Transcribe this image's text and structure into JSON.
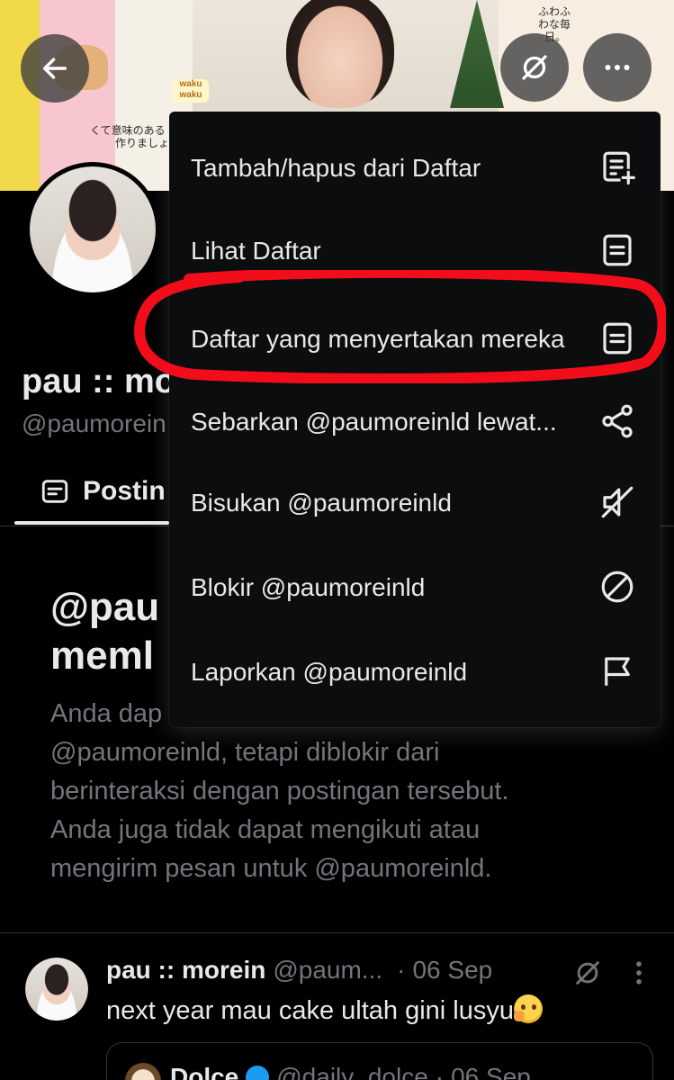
{
  "profile": {
    "name": "pau :: mo",
    "handle": "@paumorein",
    "tab_posts_label": "Postin"
  },
  "banner": {
    "sticker_jp_1": "くて意味のある",
    "sticker_jp_2": "作りましょ",
    "sticker_jp_3": "ふわふ",
    "sticker_jp_4": "わな毎",
    "sticker_jp_5": "日。",
    "waku_text": "waku waku"
  },
  "menu": {
    "items": [
      {
        "label": "Tambah/hapus dari Daftar",
        "icon": "list-add-icon"
      },
      {
        "label": "Lihat Daftar",
        "icon": "list-icon"
      },
      {
        "label": "Daftar yang menyertakan mereka",
        "icon": "list-icon"
      },
      {
        "label": "Sebarkan @paumoreinld lewat...",
        "icon": "share-icon"
      },
      {
        "label": "Bisukan @paumoreinld",
        "icon": "mute-icon"
      },
      {
        "label": "Blokir @paumoreinld",
        "icon": "block-icon"
      },
      {
        "label": "Laporkan @paumoreinld",
        "icon": "flag-icon"
      }
    ],
    "highlight_color": "#f20d1a"
  },
  "blocked_notice": {
    "title": "@pau\nmeml",
    "description": "Anda dap\n@paumoreinld, tetapi diblokir dari\nberinteraksi dengan postingan tersebut.\nAnda juga tidak dapat mengikuti atau\nmengirim pesan untuk @paumoreinld."
  },
  "post": {
    "author": "pau :: morein",
    "handle": "@paum...",
    "separator": "·",
    "date": "06 Sep",
    "text": "next year mau cake ultah gini lusyu",
    "emoji": "thinking-face-emoji"
  },
  "quote": {
    "author": "Dolce",
    "handle": "@daily_dolce",
    "separator": "·",
    "date": "06 Sep"
  },
  "colors": {
    "background": "#000000",
    "text_primary": "#e7e9ea",
    "text_secondary": "#71767b",
    "divider": "#2f3336",
    "menu_bg": "#0c0d0e",
    "verified": "#1d9bf0"
  }
}
